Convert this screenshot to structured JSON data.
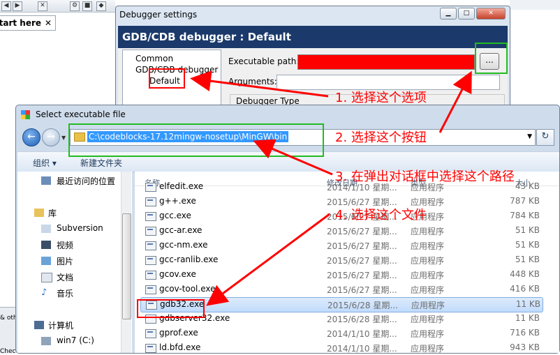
{
  "ide": {
    "tab_label": "Start here",
    "tab_close": "✕",
    "strip_text_1": "& oth",
    "strip_text_2": "Chec"
  },
  "debugger_dialog": {
    "title": "Debugger settings",
    "header": "GDB/CDB debugger : Default",
    "tree": [
      "Common",
      "GDB/CDB debugger",
      "Default"
    ],
    "executable_label": "Executable path:",
    "executable_value": "",
    "browse_label": "...",
    "arguments_label": "Arguments:",
    "debugger_type_label": "Debugger Type"
  },
  "file_dialog": {
    "title": "Select executable file",
    "address": "C:\\codeblocks-17.12mingw-nosetup\\MinGW\\bin",
    "organize_label": "组织 ▾",
    "new_folder_label": "新建文件夹",
    "nav_items": [
      {
        "label": "最近访问的位置",
        "icon": "recent-places-icon"
      },
      {
        "label": "库",
        "icon": "library-icon"
      },
      {
        "label": "Subversion",
        "icon": "document-library-icon"
      },
      {
        "label": "视频",
        "icon": "video-icon"
      },
      {
        "label": "图片",
        "icon": "pictures-icon"
      },
      {
        "label": "文档",
        "icon": "documents-icon"
      },
      {
        "label": "音乐",
        "icon": "music-icon"
      },
      {
        "label": "计算机",
        "icon": "computer-icon"
      },
      {
        "label": "win7 (C:)",
        "icon": "drive-icon"
      }
    ],
    "columns": {
      "name": "名称",
      "date": "修改日期",
      "type": "类型",
      "size": "大小"
    },
    "files": [
      {
        "name": "elfedit.exe",
        "date": "2014/1/10 星期...",
        "type": "应用程序",
        "size": "43 KB"
      },
      {
        "name": "g++.exe",
        "date": "2015/6/27 星期...",
        "type": "应用程序",
        "size": "787 KB"
      },
      {
        "name": "gcc.exe",
        "date": "2015/6/27 星期...",
        "type": "应用程序",
        "size": "784 KB"
      },
      {
        "name": "gcc-ar.exe",
        "date": "2015/6/27 星期...",
        "type": "应用程序",
        "size": "51 KB"
      },
      {
        "name": "gcc-nm.exe",
        "date": "2015/6/27 星期...",
        "type": "应用程序",
        "size": "51 KB"
      },
      {
        "name": "gcc-ranlib.exe",
        "date": "2015/6/27 星期...",
        "type": "应用程序",
        "size": "51 KB"
      },
      {
        "name": "gcov.exe",
        "date": "2015/6/27 星期...",
        "type": "应用程序",
        "size": "448 KB"
      },
      {
        "name": "gcov-tool.exe",
        "date": "2015/6/27 星期...",
        "type": "应用程序",
        "size": "416 KB"
      },
      {
        "name": "gdb32.exe",
        "date": "2015/6/28 星期...",
        "type": "应用程序",
        "size": "11 KB"
      },
      {
        "name": "gdbserver32.exe",
        "date": "2015/6/28 星期...",
        "type": "应用程序",
        "size": "11 KB"
      },
      {
        "name": "gprof.exe",
        "date": "2014/1/10 星期...",
        "type": "应用程序",
        "size": "716 KB"
      },
      {
        "name": "ld.bfd.exe",
        "date": "2014/1/10 星期...",
        "type": "应用程序",
        "size": "943 KB"
      }
    ],
    "selected_index": 8
  },
  "annotations": {
    "step1": "1. 选择这个选项",
    "step2": "2. 选择这个按钮",
    "step3": "3. 在弹出对话框中选择这个路径",
    "step4": "4. 选择这个文件",
    "color": "#ff0000",
    "highlight_color": "#22bb22"
  }
}
